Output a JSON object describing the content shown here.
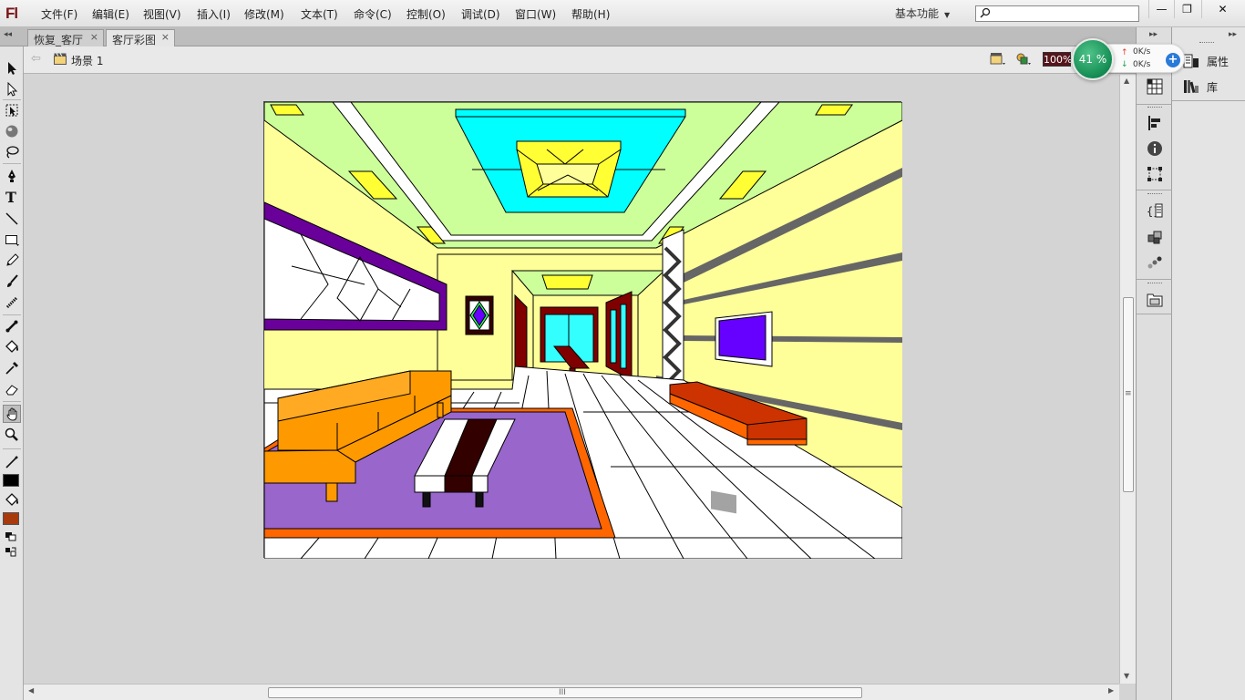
{
  "app": {
    "logo": "Fl"
  },
  "menu": [
    {
      "label": "文件(F)"
    },
    {
      "label": "编辑(E)"
    },
    {
      "label": "视图(V)"
    },
    {
      "label": "插入(I)"
    },
    {
      "label": "修改(M)"
    },
    {
      "label": "文本(T)"
    },
    {
      "label": "命令(C)"
    },
    {
      "label": "控制(O)"
    },
    {
      "label": "调试(D)"
    },
    {
      "label": "窗口(W)"
    },
    {
      "label": "帮助(H)"
    }
  ],
  "workspace": {
    "label": "基本功能",
    "caret": "▼"
  },
  "search": {
    "placeholder": "",
    "icon": "search-icon"
  },
  "window_controls": {
    "minimize": "—",
    "restore": "❐",
    "close": "✕"
  },
  "tabs": [
    {
      "label": "恢复_客厅",
      "close": "×",
      "active": false
    },
    {
      "label": "客厅彩图",
      "close": "×",
      "active": true
    }
  ],
  "editbar": {
    "scene_label": "场景 1",
    "zoom": "100%"
  },
  "net_monitor": {
    "percent": "41 %",
    "upload": "0K/s",
    "download": "0K/s",
    "plus": "+"
  },
  "toolbar": {
    "tools": [
      {
        "name": "selection-tool",
        "icon": "arrow-icon"
      },
      {
        "name": "subselection-tool",
        "icon": "white-arrow-icon"
      },
      {
        "name": "free-transform-tool",
        "icon": "transform-icon"
      },
      {
        "name": "3d-rotation-tool",
        "icon": "sphere-icon"
      },
      {
        "name": "lasso-tool",
        "icon": "lasso-icon"
      },
      {
        "name": "pen-tool",
        "icon": "pen-icon"
      },
      {
        "name": "text-tool",
        "icon": "text-icon"
      },
      {
        "name": "line-tool",
        "icon": "line-icon"
      },
      {
        "name": "rectangle-tool",
        "icon": "rectangle-icon"
      },
      {
        "name": "pencil-tool",
        "icon": "pencil-icon"
      },
      {
        "name": "brush-tool",
        "icon": "brush-icon"
      },
      {
        "name": "deco-tool",
        "icon": "deco-icon"
      },
      {
        "name": "bone-tool",
        "icon": "bone-icon"
      },
      {
        "name": "paint-bucket-tool",
        "icon": "bucket-icon"
      },
      {
        "name": "eyedropper-tool",
        "icon": "eyedropper-icon"
      },
      {
        "name": "eraser-tool",
        "icon": "eraser-icon"
      },
      {
        "name": "hand-tool",
        "icon": "hand-icon"
      },
      {
        "name": "zoom-tool",
        "icon": "magnifier-icon"
      }
    ],
    "text_tool_glyph": "T",
    "stroke_color": "#000000",
    "fill_color": "#a83a0c"
  },
  "right_panel": {
    "entries": [
      {
        "label": "属性",
        "icon": "properties-icon"
      },
      {
        "label": "库",
        "icon": "library-icon"
      }
    ]
  },
  "scrollbars": {
    "grip": "≡",
    "h_grip": "III"
  },
  "colors": {
    "accent": "#55151b",
    "wall": "#ffff99",
    "ceiling": "#ccff99",
    "cyan": "#00ffff",
    "purple": "#6a009a",
    "rug": "#9966cc",
    "rug_border": "#ff6600",
    "sofa": "#ff9900",
    "tv_cabinet": "#cc3300",
    "tv_screen": "#6600ff",
    "wood": "#800000",
    "dark_table": "#330000"
  }
}
